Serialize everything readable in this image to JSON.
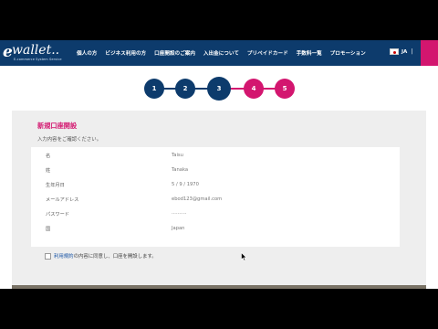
{
  "logo": {
    "mark": "e",
    "word": "wallet..",
    "sub": "E-commerce System Service"
  },
  "nav": {
    "items": [
      "個人の方",
      "ビジネス利用の方",
      "口座開設のご案内",
      "入出金について",
      "プリペイドカード",
      "手数料一覧",
      "プロモーション"
    ]
  },
  "lang": {
    "code": "JA",
    "separator": "|"
  },
  "steps": [
    "1",
    "2",
    "3",
    "4",
    "5"
  ],
  "colors": {
    "navy": "#0d3b6c",
    "pink": "#d3166f",
    "panel": "#eeeeee"
  },
  "form": {
    "title": "新規口座開設",
    "instruction": "入力内容をご確認ください。",
    "fields": [
      {
        "label": "名",
        "value": "Taisu"
      },
      {
        "label": "姓",
        "value": "Tanaka"
      },
      {
        "label": "生年月日",
        "value": "5 / 9 / 1970"
      },
      {
        "label": "メールアドレス",
        "value": "ebod123@gmail.com"
      },
      {
        "label": "パスワード",
        "value": "··········"
      },
      {
        "label": "国",
        "value": "Japan"
      }
    ]
  },
  "agree": {
    "link": "利用規約",
    "text": "の内容に同意し、口座を開設します。"
  }
}
